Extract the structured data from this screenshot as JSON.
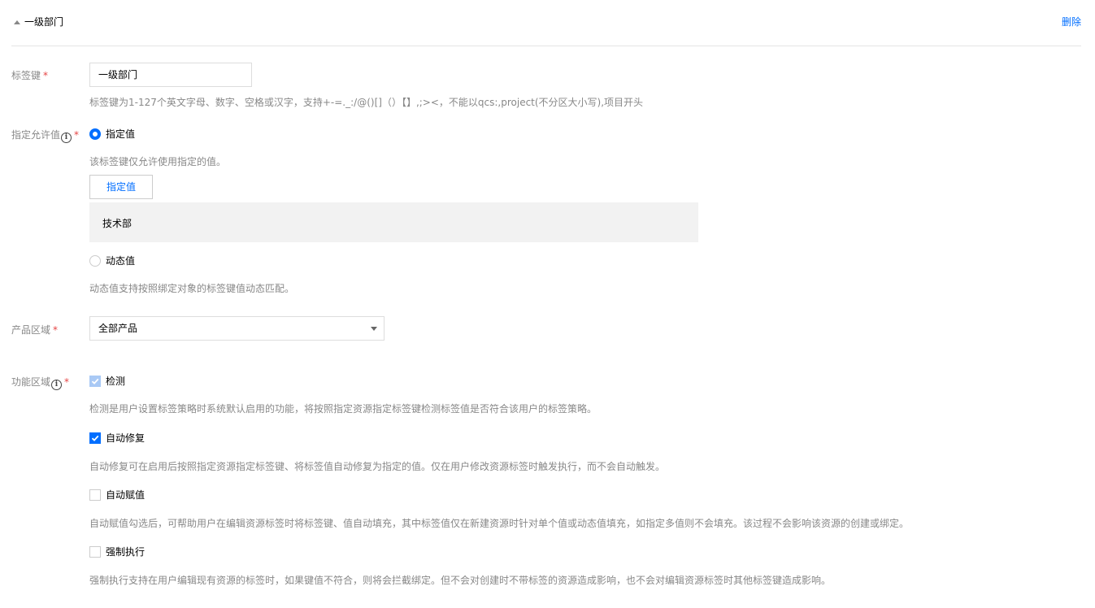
{
  "section": {
    "title": "一级部门",
    "delete_label": "删除"
  },
  "tag_key": {
    "label": "标签键",
    "required_mark": "*",
    "value": "一级部门",
    "hint": "标签键为1-127个英文字母、数字、空格或汉字，支持+-=._:/@()[]（）【】,;><，不能以qcs:,project(不分区大小写),项目开头"
  },
  "allowed_values": {
    "label": "指定允许值",
    "required_mark": "*",
    "info_icon": "i",
    "option_specified": {
      "label": "指定值",
      "selected": true,
      "desc": "该标签键仅允许使用指定的值。",
      "button_label": "指定值",
      "values": [
        "技术部"
      ]
    },
    "option_dynamic": {
      "label": "动态值",
      "selected": false,
      "desc": "动态值支持按照绑定对象的标签键值动态匹配。"
    }
  },
  "product_scope": {
    "label": "产品区域",
    "required_mark": "*",
    "selected": "全部产品",
    "icon": "chevron-down-icon"
  },
  "function_scope": {
    "label": "功能区域",
    "required_mark": "*",
    "info_icon": "i",
    "options": [
      {
        "label": "检测",
        "checked": true,
        "disabled": true,
        "desc": "检测是用户设置标签策略时系统默认启用的功能，将按照指定资源指定标签键检测标签值是否符合该用户的标签策略。"
      },
      {
        "label": "自动修复",
        "checked": true,
        "disabled": false,
        "desc": "自动修复可在启用后按照指定资源指定标签键、将标签值自动修复为指定的值。仅在用户修改资源标签时触发执行，而不会自动触发。"
      },
      {
        "label": "自动赋值",
        "checked": false,
        "disabled": false,
        "desc": "自动赋值勾选后，可帮助用户在编辑资源标签时将标签键、值自动填充，其中标签值仅在新建资源时针对单个值或动态值填充，如指定多值则不会填充。该过程不会影响该资源的创建或绑定。"
      },
      {
        "label": "强制执行",
        "checked": false,
        "disabled": false,
        "desc": "强制执行支持在用户编辑现有资源的标签时，如果键值不符合，则将会拦截绑定。但不会对创建时不带标签的资源造成影响，也不会对编辑资源标签时其他标签键造成影响。"
      }
    ]
  },
  "colors": {
    "accent": "#006eff",
    "required": "#e54545",
    "hint": "#888888",
    "border": "#dddddd",
    "panel": "#f2f2f2"
  }
}
